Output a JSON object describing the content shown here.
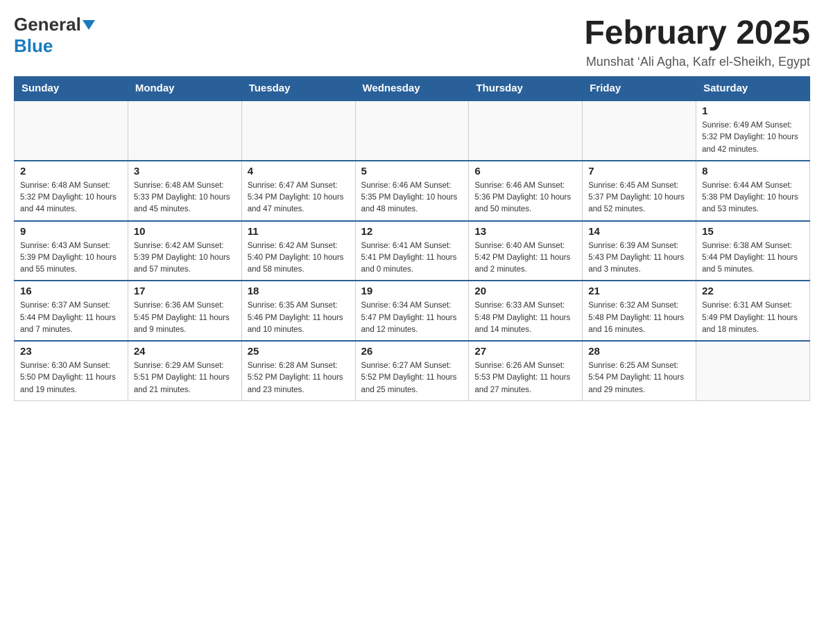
{
  "header": {
    "logo_general": "General",
    "logo_blue": "Blue",
    "title": "February 2025",
    "location": "Munshat ‘Ali Agha, Kafr el-Sheikh, Egypt"
  },
  "days_of_week": [
    "Sunday",
    "Monday",
    "Tuesday",
    "Wednesday",
    "Thursday",
    "Friday",
    "Saturday"
  ],
  "weeks": [
    [
      {
        "day": "",
        "info": ""
      },
      {
        "day": "",
        "info": ""
      },
      {
        "day": "",
        "info": ""
      },
      {
        "day": "",
        "info": ""
      },
      {
        "day": "",
        "info": ""
      },
      {
        "day": "",
        "info": ""
      },
      {
        "day": "1",
        "info": "Sunrise: 6:49 AM\nSunset: 5:32 PM\nDaylight: 10 hours and 42 minutes."
      }
    ],
    [
      {
        "day": "2",
        "info": "Sunrise: 6:48 AM\nSunset: 5:32 PM\nDaylight: 10 hours and 44 minutes."
      },
      {
        "day": "3",
        "info": "Sunrise: 6:48 AM\nSunset: 5:33 PM\nDaylight: 10 hours and 45 minutes."
      },
      {
        "day": "4",
        "info": "Sunrise: 6:47 AM\nSunset: 5:34 PM\nDaylight: 10 hours and 47 minutes."
      },
      {
        "day": "5",
        "info": "Sunrise: 6:46 AM\nSunset: 5:35 PM\nDaylight: 10 hours and 48 minutes."
      },
      {
        "day": "6",
        "info": "Sunrise: 6:46 AM\nSunset: 5:36 PM\nDaylight: 10 hours and 50 minutes."
      },
      {
        "day": "7",
        "info": "Sunrise: 6:45 AM\nSunset: 5:37 PM\nDaylight: 10 hours and 52 minutes."
      },
      {
        "day": "8",
        "info": "Sunrise: 6:44 AM\nSunset: 5:38 PM\nDaylight: 10 hours and 53 minutes."
      }
    ],
    [
      {
        "day": "9",
        "info": "Sunrise: 6:43 AM\nSunset: 5:39 PM\nDaylight: 10 hours and 55 minutes."
      },
      {
        "day": "10",
        "info": "Sunrise: 6:42 AM\nSunset: 5:39 PM\nDaylight: 10 hours and 57 minutes."
      },
      {
        "day": "11",
        "info": "Sunrise: 6:42 AM\nSunset: 5:40 PM\nDaylight: 10 hours and 58 minutes."
      },
      {
        "day": "12",
        "info": "Sunrise: 6:41 AM\nSunset: 5:41 PM\nDaylight: 11 hours and 0 minutes."
      },
      {
        "day": "13",
        "info": "Sunrise: 6:40 AM\nSunset: 5:42 PM\nDaylight: 11 hours and 2 minutes."
      },
      {
        "day": "14",
        "info": "Sunrise: 6:39 AM\nSunset: 5:43 PM\nDaylight: 11 hours and 3 minutes."
      },
      {
        "day": "15",
        "info": "Sunrise: 6:38 AM\nSunset: 5:44 PM\nDaylight: 11 hours and 5 minutes."
      }
    ],
    [
      {
        "day": "16",
        "info": "Sunrise: 6:37 AM\nSunset: 5:44 PM\nDaylight: 11 hours and 7 minutes."
      },
      {
        "day": "17",
        "info": "Sunrise: 6:36 AM\nSunset: 5:45 PM\nDaylight: 11 hours and 9 minutes."
      },
      {
        "day": "18",
        "info": "Sunrise: 6:35 AM\nSunset: 5:46 PM\nDaylight: 11 hours and 10 minutes."
      },
      {
        "day": "19",
        "info": "Sunrise: 6:34 AM\nSunset: 5:47 PM\nDaylight: 11 hours and 12 minutes."
      },
      {
        "day": "20",
        "info": "Sunrise: 6:33 AM\nSunset: 5:48 PM\nDaylight: 11 hours and 14 minutes."
      },
      {
        "day": "21",
        "info": "Sunrise: 6:32 AM\nSunset: 5:48 PM\nDaylight: 11 hours and 16 minutes."
      },
      {
        "day": "22",
        "info": "Sunrise: 6:31 AM\nSunset: 5:49 PM\nDaylight: 11 hours and 18 minutes."
      }
    ],
    [
      {
        "day": "23",
        "info": "Sunrise: 6:30 AM\nSunset: 5:50 PM\nDaylight: 11 hours and 19 minutes."
      },
      {
        "day": "24",
        "info": "Sunrise: 6:29 AM\nSunset: 5:51 PM\nDaylight: 11 hours and 21 minutes."
      },
      {
        "day": "25",
        "info": "Sunrise: 6:28 AM\nSunset: 5:52 PM\nDaylight: 11 hours and 23 minutes."
      },
      {
        "day": "26",
        "info": "Sunrise: 6:27 AM\nSunset: 5:52 PM\nDaylight: 11 hours and 25 minutes."
      },
      {
        "day": "27",
        "info": "Sunrise: 6:26 AM\nSunset: 5:53 PM\nDaylight: 11 hours and 27 minutes."
      },
      {
        "day": "28",
        "info": "Sunrise: 6:25 AM\nSunset: 5:54 PM\nDaylight: 11 hours and 29 minutes."
      },
      {
        "day": "",
        "info": ""
      }
    ]
  ]
}
